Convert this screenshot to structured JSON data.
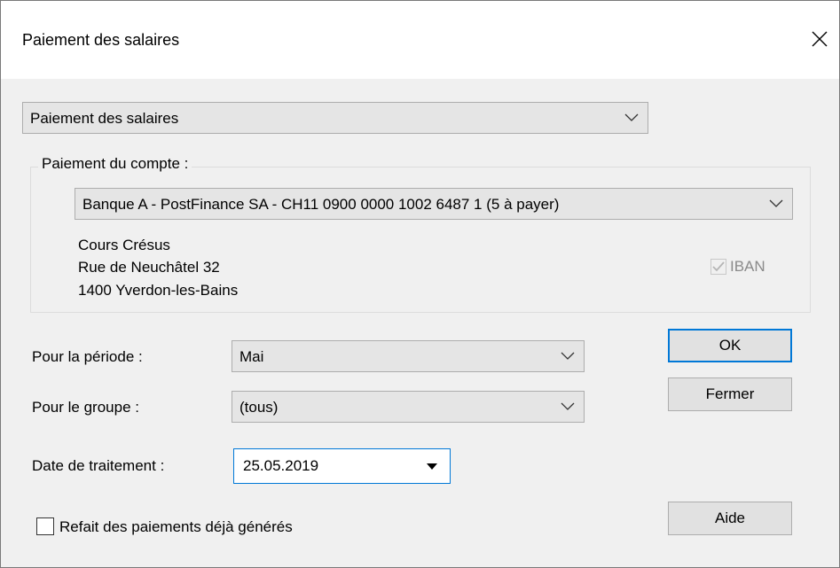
{
  "dialog": {
    "title": "Paiement des salaires"
  },
  "payment_type": {
    "selected": "Paiement des salaires"
  },
  "account_group": {
    "label": "Paiement du compte :",
    "account_selected": "Banque A - PostFinance SA - CH11 0900 0000 1002 6487 1 (5 à payer)",
    "address": [
      "Cours Crésus",
      "Rue de Neuchâtel 32",
      "1400 Yverdon-les-Bains"
    ],
    "iban_label": "IBAN"
  },
  "period": {
    "label": "Pour la période :",
    "selected": "Mai"
  },
  "group": {
    "label": "Pour le groupe :",
    "selected": "(tous)"
  },
  "processing_date": {
    "label": "Date de traitement :",
    "value": "25.05.2019"
  },
  "redo": {
    "label": "Refait des paiements déjà générés"
  },
  "buttons": {
    "ok": "OK",
    "close": "Fermer",
    "help": "Aide"
  },
  "colors": {
    "focus": "#0078d7",
    "button_face": "#e1e1e1",
    "background": "#f0f0f0"
  }
}
